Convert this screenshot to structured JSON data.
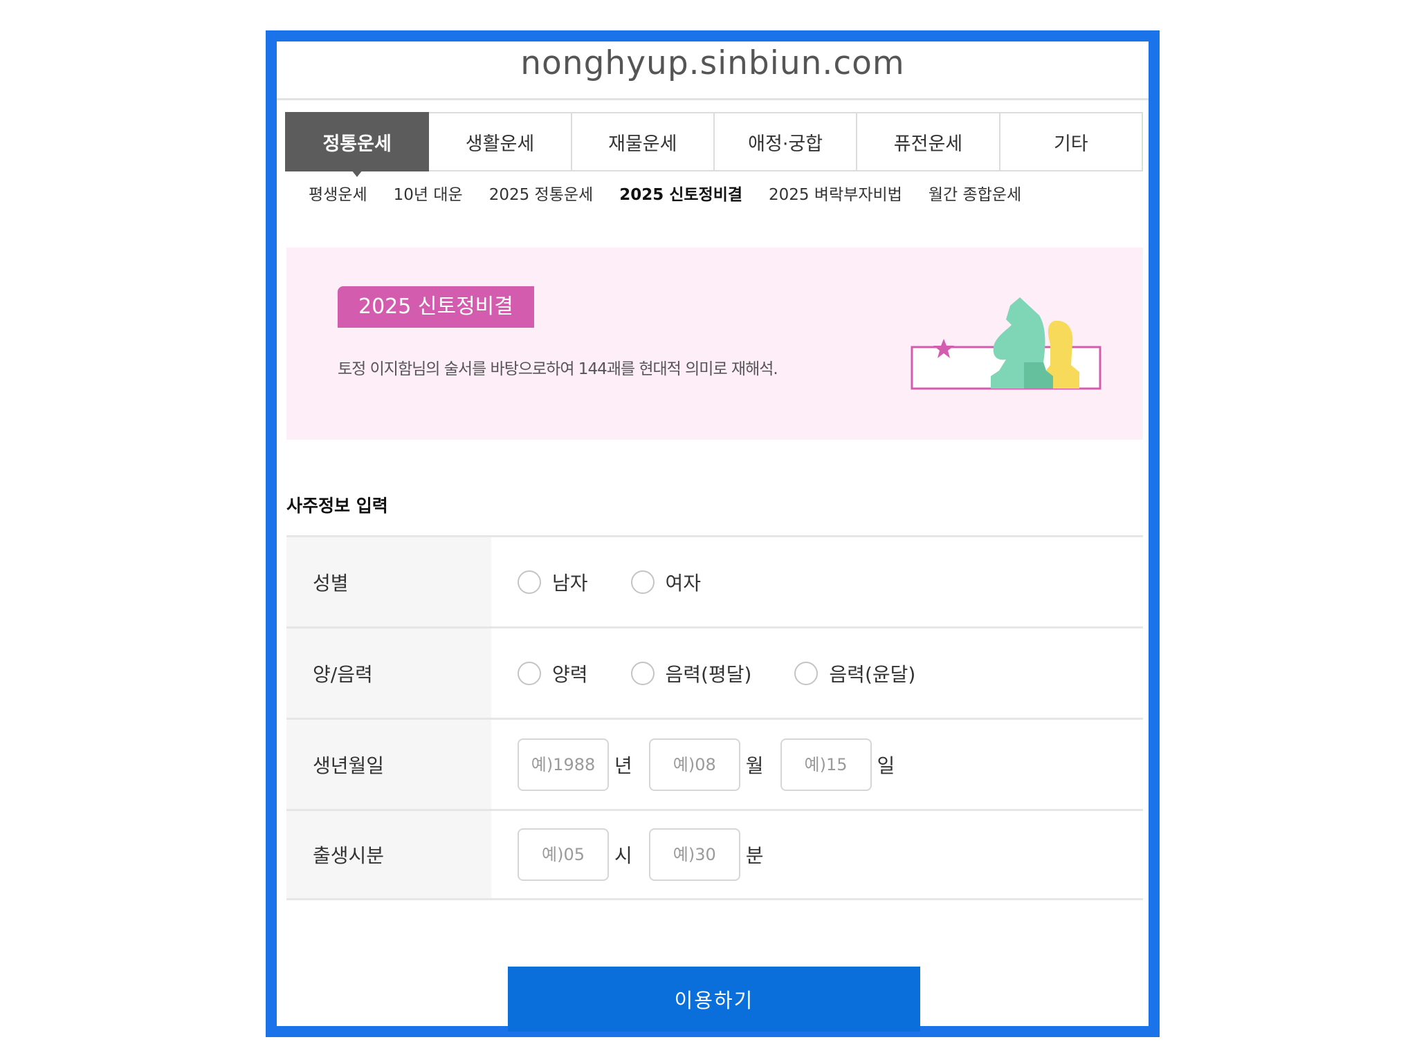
{
  "site": {
    "url": "nonghyup.sinbiun.com"
  },
  "tabs": [
    {
      "label": "정통운세",
      "active": true
    },
    {
      "label": "생활운세",
      "active": false
    },
    {
      "label": "재물운세",
      "active": false
    },
    {
      "label": "애정·궁합",
      "active": false
    },
    {
      "label": "퓨전운세",
      "active": false
    },
    {
      "label": "기타",
      "active": false
    }
  ],
  "subtabs": [
    {
      "label": "평생운세",
      "active": false
    },
    {
      "label": "10년 대운",
      "active": false
    },
    {
      "label": "2025 정통운세",
      "active": false
    },
    {
      "label": "2025 신토정비결",
      "active": true
    },
    {
      "label": "2025 벼락부자비법",
      "active": false
    },
    {
      "label": "월간 종합운세",
      "active": false
    }
  ],
  "banner": {
    "badge": "2025 신토정비결",
    "description": "토정 이지함님의 술서를 바탕으로하여 144괘를 현대적 의미로 재해석.",
    "background_color": "#fdeef8",
    "badge_color": "#d45cae"
  },
  "form": {
    "section_title": "사주정보 입력",
    "gender": {
      "label": "성별",
      "options": [
        "남자",
        "여자"
      ]
    },
    "calendar": {
      "label": "양/음력",
      "options": [
        "양력",
        "음력(평달)",
        "음력(윤달)"
      ]
    },
    "birth_date": {
      "label": "생년월일",
      "year_placeholder": "예)1988",
      "year_unit": "년",
      "month_placeholder": "예)08",
      "month_unit": "월",
      "day_placeholder": "예)15",
      "day_unit": "일"
    },
    "birth_time": {
      "label": "출생시분",
      "hour_placeholder": "예)05",
      "hour_unit": "시",
      "minute_placeholder": "예)30",
      "minute_unit": "분"
    }
  },
  "submit_label": "이용하기",
  "colors": {
    "frame": "#1a73e8",
    "submit": "#0a6fdb",
    "active_tab": "#5c5c5c"
  }
}
